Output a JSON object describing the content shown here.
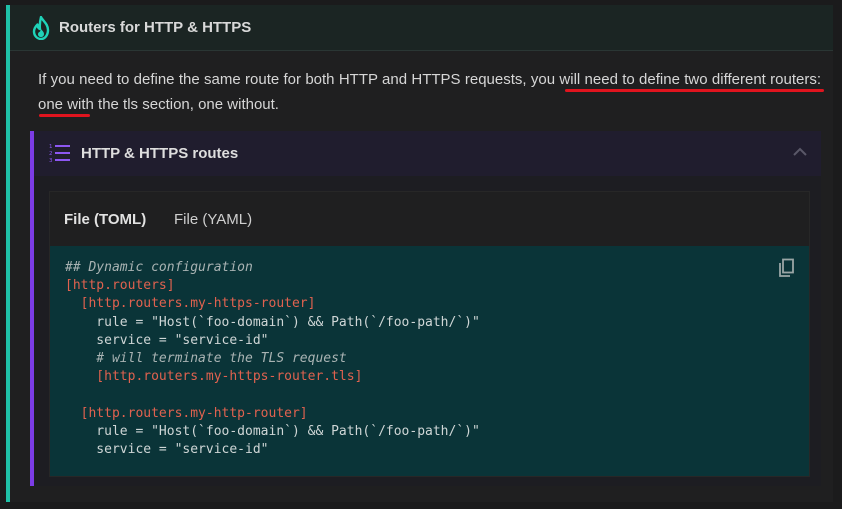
{
  "admonition": {
    "icon": "flame-icon",
    "title": "Routers for HTTP & HTTPS",
    "para_part1": "If you need to define the same route for both HTTP and HTTPS requests, ",
    "para_underlined": "you will need to define two different routers",
    "para_part2": ": one with the tls section, one without.",
    "highlight_color": "#e0141e",
    "accent": "#1fc1a8"
  },
  "details": {
    "icon": "numbered-list-icon",
    "title": "HTTP & HTTPS routes",
    "toggle_icon": "chevron-up-icon",
    "accent": "#7c3ce6"
  },
  "tabs": [
    {
      "label": "File (TOML)",
      "active": true
    },
    {
      "label": "File (YAML)",
      "active": false
    }
  ],
  "code": {
    "copy_icon": "copy-icon",
    "lines": [
      {
        "text": "## Dynamic configuration",
        "kind": "comment"
      },
      {
        "text": "[http.routers]",
        "kind": "section"
      },
      {
        "text": "  [http.routers.my-https-router]",
        "kind": "section"
      },
      {
        "text": "    rule = \"Host(`foo-domain`) && Path(`/foo-path/`)\"",
        "kind": "plain"
      },
      {
        "text": "    service = \"service-id\"",
        "kind": "plain"
      },
      {
        "text": "    # will terminate the TLS request",
        "kind": "comment"
      },
      {
        "text": "    [http.routers.my-https-router.tls]",
        "kind": "section"
      },
      {
        "text": "",
        "kind": "plain"
      },
      {
        "text": "  [http.routers.my-http-router]",
        "kind": "section"
      },
      {
        "text": "    rule = \"Host(`foo-domain`) && Path(`/foo-path/`)\"",
        "kind": "plain"
      },
      {
        "text": "    service = \"service-id\"",
        "kind": "plain"
      }
    ]
  }
}
